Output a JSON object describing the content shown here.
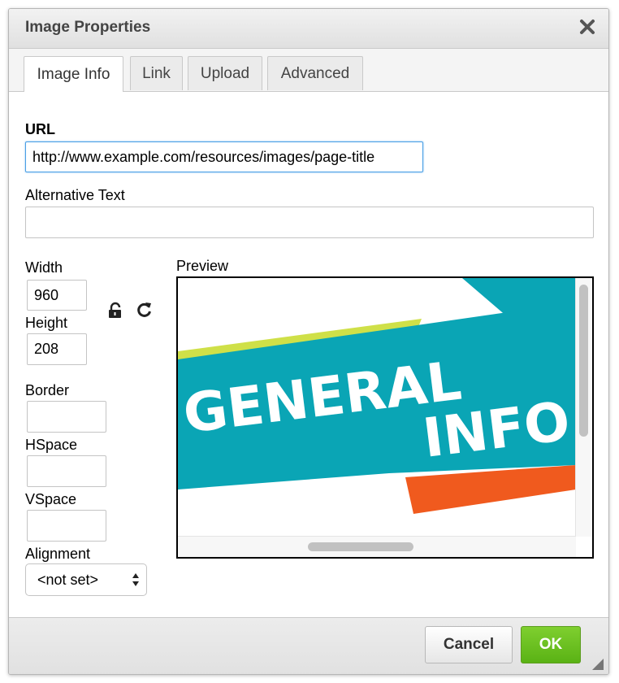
{
  "dialog": {
    "title": "Image Properties",
    "close_icon": "close-icon"
  },
  "tabs": [
    {
      "label": "Image Info",
      "active": true
    },
    {
      "label": "Link",
      "active": false
    },
    {
      "label": "Upload",
      "active": false
    },
    {
      "label": "Advanced",
      "active": false
    }
  ],
  "form": {
    "url_label": "URL",
    "url_value": "http://www.example.com/resources/images/page-title",
    "alt_label": "Alternative Text",
    "alt_value": "",
    "width_label": "Width",
    "width_value": "960",
    "height_label": "Height",
    "height_value": "208",
    "lock_icon": "lock-icon",
    "reset_icon": "reset-size-icon",
    "border_label": "Border",
    "border_value": "",
    "hspace_label": "HSpace",
    "hspace_value": "",
    "vspace_label": "VSpace",
    "vspace_value": "",
    "alignment_label": "Alignment",
    "alignment_value": "<not set>",
    "preview_label": "Preview"
  },
  "preview_image": {
    "line1": "GENERAL",
    "line2": "INFO"
  },
  "footer": {
    "cancel_label": "Cancel",
    "ok_label": "OK"
  },
  "colors": {
    "ok_green": "#6cc123",
    "banner_teal": "#0aa5b5",
    "banner_dark_teal": "#0a7f8f",
    "accent_yellow": "#cfe048",
    "accent_orange": "#f05a1e"
  }
}
